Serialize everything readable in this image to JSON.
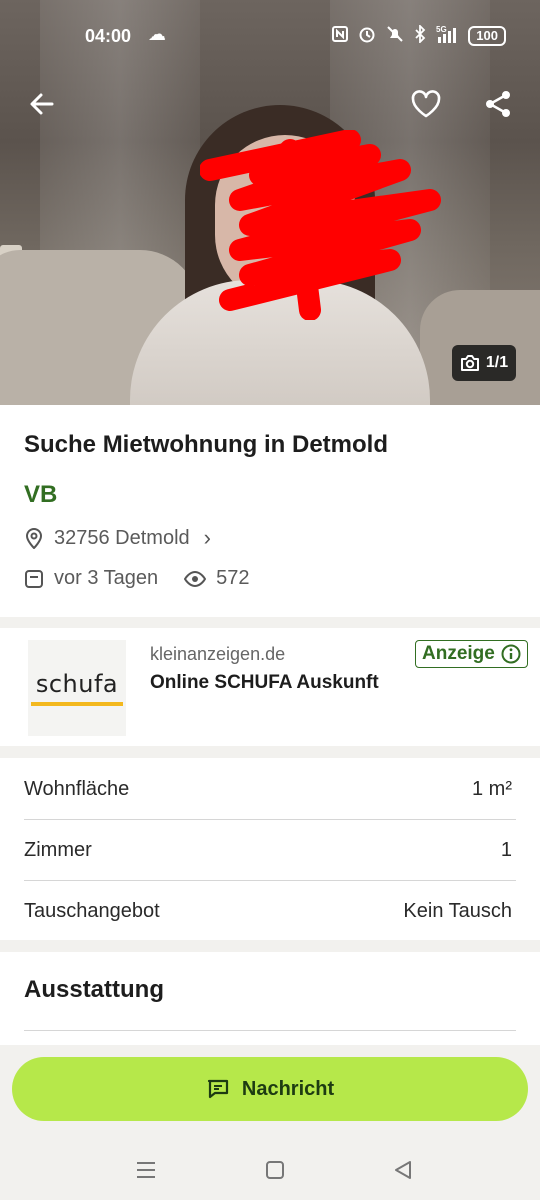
{
  "status_bar": {
    "time": "04:00",
    "battery": "100",
    "network": "5G"
  },
  "photo": {
    "counter": "1/1"
  },
  "listing": {
    "title": "Suche Mietwohnung in Detmold",
    "price": "VB",
    "location": "32756 Detmold",
    "posted": "vor 3 Tagen",
    "views": "572"
  },
  "ad": {
    "logo_text": "schufa",
    "source": "kleinanzeigen.de",
    "title": "Online SCHUFA Auskunft",
    "badge": "Anzeige"
  },
  "details": [
    {
      "label": "Wohnfläche",
      "value": "1 m²"
    },
    {
      "label": "Zimmer",
      "value": "1"
    },
    {
      "label": "Tauschangebot",
      "value": "Kein Tausch"
    }
  ],
  "features": {
    "heading": "Ausstattung"
  },
  "actions": {
    "message_label": "Nachricht"
  },
  "colors": {
    "accent_green": "#326e22",
    "button_lime": "#b6e84a",
    "redaction_red": "#ff0000"
  }
}
